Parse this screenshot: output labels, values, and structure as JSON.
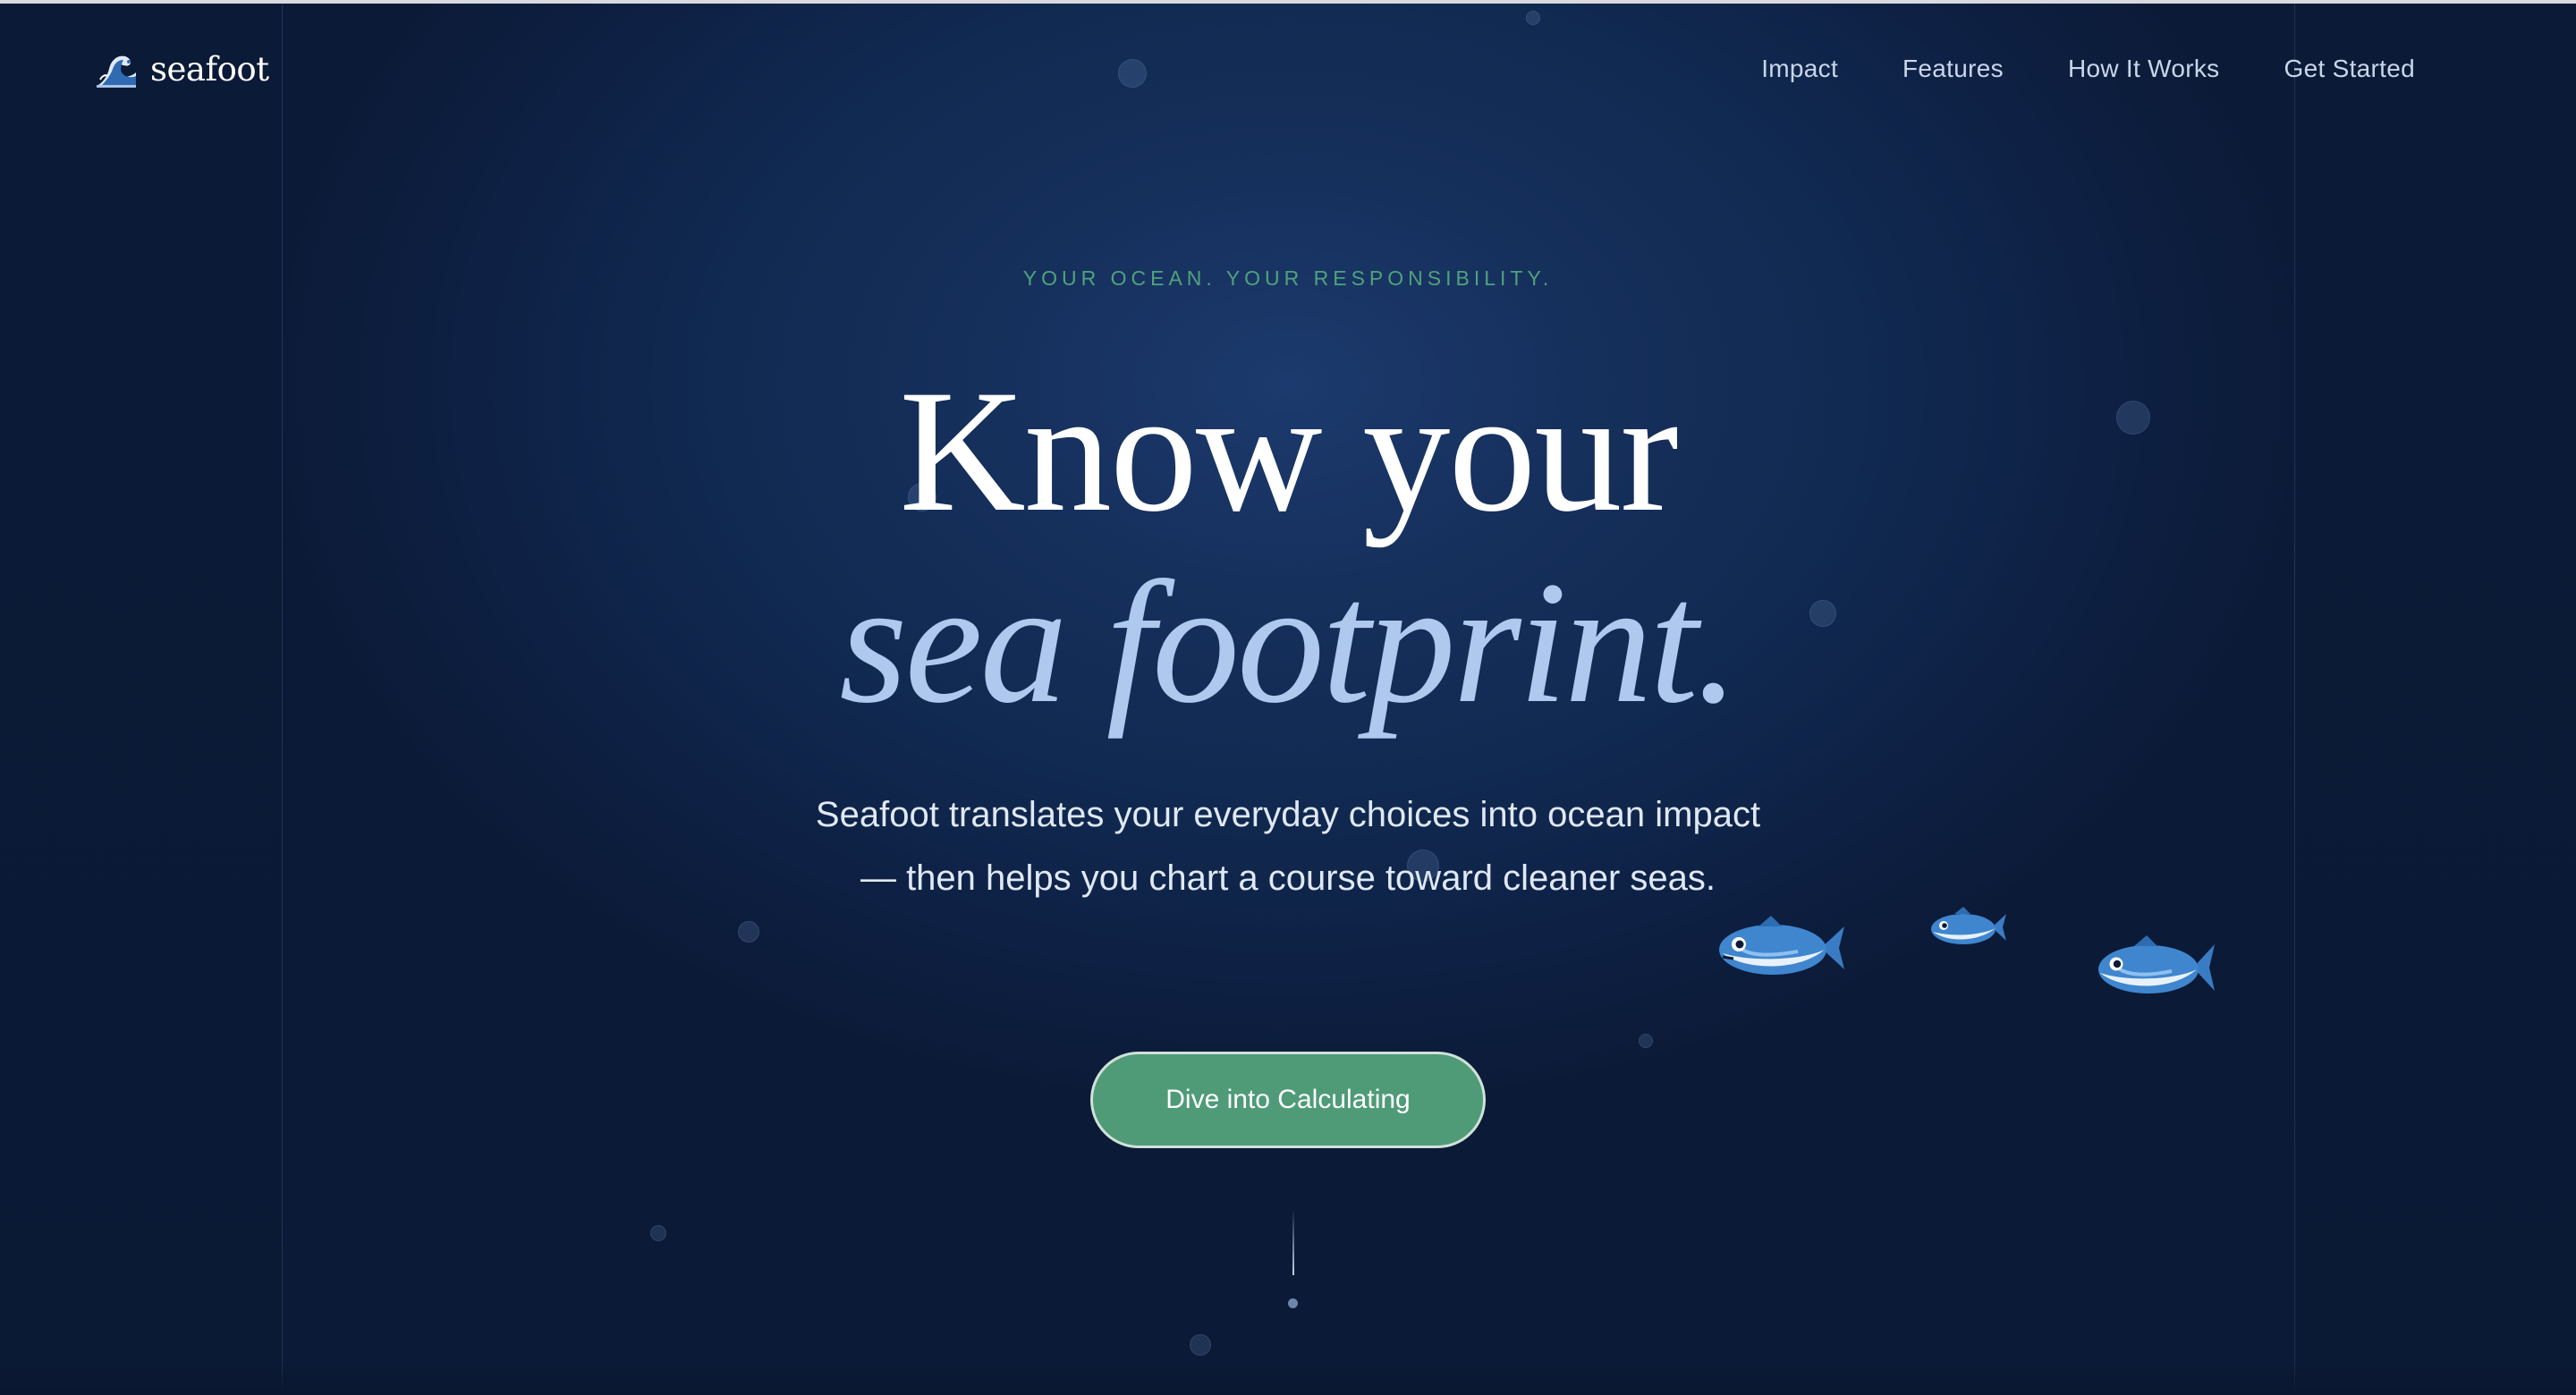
{
  "brand": {
    "name": "seafoot",
    "logo_icon": "wave-icon"
  },
  "nav": {
    "items": [
      {
        "label": "Impact"
      },
      {
        "label": "Features"
      },
      {
        "label": "How It Works"
      },
      {
        "label": "Get Started"
      }
    ]
  },
  "hero": {
    "eyebrow": "YOUR OCEAN. YOUR RESPONSIBILITY.",
    "headline_line1": "Know your",
    "headline_line2": "sea footprint.",
    "subtext": "Seafoot translates your everyday choices into ocean impact — then helps you chart a course toward cleaner seas.",
    "cta_label": "Dive into Calculating"
  },
  "decor": {
    "fish_icon": "fish-icon",
    "scroll_indicator_icon": "scroll-indicator-icon"
  },
  "colors": {
    "background": "#112a51",
    "accent_green": "#4f9b78",
    "eyebrow_green": "#4fa37b",
    "headline_italic": "#aec8ee",
    "nav_text": "#c9d6ea"
  }
}
